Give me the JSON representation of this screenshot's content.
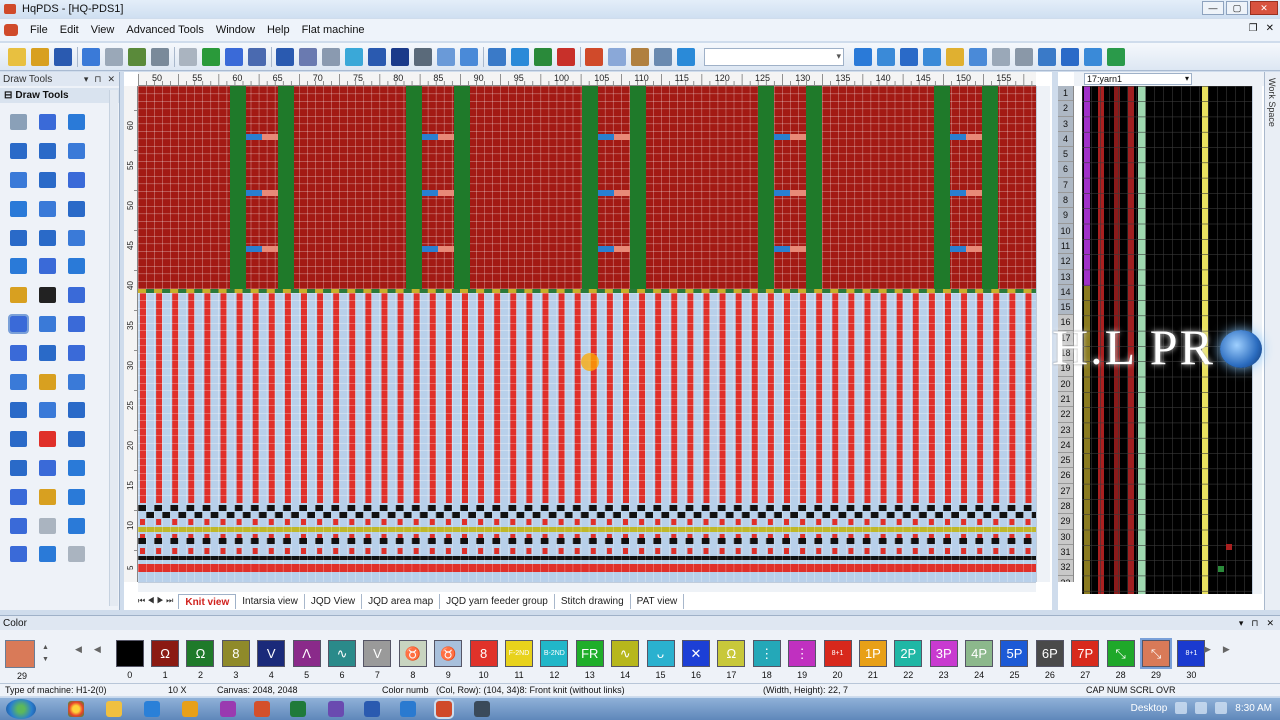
{
  "window": {
    "title": "HqPDS - [HQ-PDS1]"
  },
  "menu": [
    "File",
    "Edit",
    "View",
    "Advanced Tools",
    "Window",
    "Help",
    "Flat machine"
  ],
  "left_panel": {
    "title": "Draw Tools",
    "group": "Draw Tools"
  },
  "tabs": [
    "Knit view",
    "Intarsia view",
    "JQD View",
    "JQD area map",
    "JQD yarn feeder group",
    "Stitch drawing",
    "PAT view"
  ],
  "active_tab": "Knit view",
  "workspace": {
    "combo": "17:yarn1",
    "side_label": "Work Space",
    "watermark": "H.L PR"
  },
  "ruler": {
    "h_labels": [
      "50",
      "55",
      "60",
      "65",
      "70",
      "75",
      "80",
      "85",
      "90",
      "95",
      "100",
      "105",
      "110",
      "115",
      "120",
      "125",
      "130",
      "135",
      "140",
      "145",
      "150",
      "155",
      "160"
    ],
    "v_labels": [
      "60",
      "55",
      "50",
      "45",
      "40",
      "35",
      "30",
      "25",
      "20",
      "15",
      "10",
      "5"
    ]
  },
  "workspace_rows": [
    "1",
    "2",
    "3",
    "4",
    "5",
    "6",
    "7",
    "8",
    "9",
    "10",
    "11",
    "12",
    "13",
    "14",
    "15",
    "16",
    "17",
    "18",
    "19",
    "20",
    "21",
    "22",
    "23",
    "24",
    "25",
    "26",
    "27",
    "28",
    "29",
    "30",
    "31",
    "32",
    "33"
  ],
  "color_panel": {
    "title": "Color",
    "current": {
      "num": "29",
      "color": "#d97a58"
    },
    "swatches": [
      {
        "num": "0",
        "color": "#000000",
        "sym": ""
      },
      {
        "num": "1",
        "color": "#8b1a12",
        "sym": "Ω"
      },
      {
        "num": "2",
        "color": "#1f7a2a",
        "sym": "Ω"
      },
      {
        "num": "3",
        "color": "#8f8a2a",
        "sym": "8"
      },
      {
        "num": "4",
        "color": "#1a2a7a",
        "sym": "V"
      },
      {
        "num": "5",
        "color": "#8a2a8a",
        "sym": "Λ"
      },
      {
        "num": "6",
        "color": "#2a8a8a",
        "sym": "∿"
      },
      {
        "num": "7",
        "color": "#9a9a9a",
        "sym": "V"
      },
      {
        "num": "8",
        "color": "#c8d4c0",
        "sym": "♉"
      },
      {
        "num": "9",
        "color": "#a8c0dc",
        "sym": "♉"
      },
      {
        "num": "10",
        "color": "#e0322a",
        "sym": "8"
      },
      {
        "num": "11",
        "color": "#e8d21c",
        "sym": "F-2ND"
      },
      {
        "num": "12",
        "color": "#21b7c9",
        "sym": "B-2ND"
      },
      {
        "num": "13",
        "color": "#1fae2a",
        "sym": "FR"
      },
      {
        "num": "14",
        "color": "#b7b71c",
        "sym": "∿"
      },
      {
        "num": "15",
        "color": "#2ab1cf",
        "sym": "ᴗ"
      },
      {
        "num": "16",
        "color": "#1c3fd6",
        "sym": "✕"
      },
      {
        "num": "17",
        "color": "#c8c83a",
        "sym": "Ω"
      },
      {
        "num": "18",
        "color": "#24a8b8",
        "sym": "⋮"
      },
      {
        "num": "19",
        "color": "#c030c0",
        "sym": "⋮"
      },
      {
        "num": "20",
        "color": "#d8281c",
        "sym": "8+1"
      },
      {
        "num": "21",
        "color": "#e8a018",
        "sym": "1P"
      },
      {
        "num": "22",
        "color": "#1fb7a5",
        "sym": "2P"
      },
      {
        "num": "23",
        "color": "#c83ad0",
        "sym": "3P"
      },
      {
        "num": "24",
        "color": "#8cb88c",
        "sym": "4P"
      },
      {
        "num": "25",
        "color": "#1c5ad6",
        "sym": "5P"
      },
      {
        "num": "26",
        "color": "#4a4a4a",
        "sym": "6P"
      },
      {
        "num": "27",
        "color": "#d82a1c",
        "sym": "7P"
      },
      {
        "num": "28",
        "color": "#1fa82a",
        "sym": "⤡"
      },
      {
        "num": "29",
        "color": "#d97a58",
        "sym": "⤡"
      },
      {
        "num": "30",
        "color": "#1a3ad0",
        "sym": "8+1"
      }
    ]
  },
  "status": {
    "machine": "Type of machine: H1-2(0)",
    "zoom": "10 X",
    "canvas": "Canvas: 2048, 2048",
    "color_num": "Color numb",
    "colrow": "(Col, Row): (104, 34)8: Front knit (without links)",
    "size": "(Width, Height): 22, 7",
    "keys": "CAP  NUM  SCRL  OVR"
  },
  "taskbar": {
    "desktop": "Desktop",
    "time": "8:30 AM"
  },
  "colors": {
    "maroon": "#a31a14",
    "green": "#1f7a2a",
    "light_blue": "#b8d0ea",
    "red": "#e0302a",
    "blue_mark": "#2a7fd0",
    "salmon": "#e88a78",
    "yellow_olive": "#c0b828"
  }
}
